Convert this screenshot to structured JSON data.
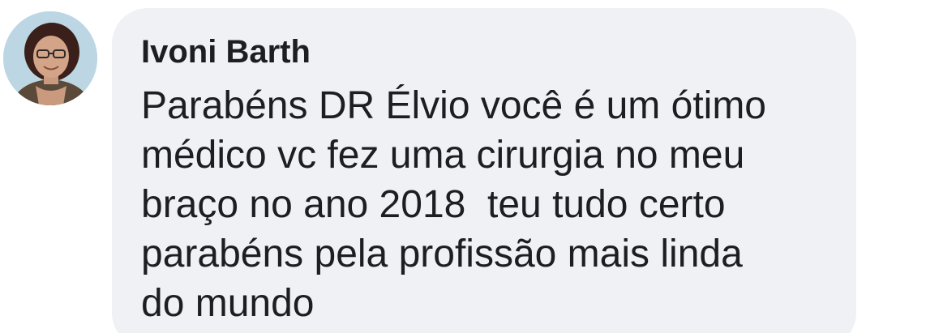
{
  "comment": {
    "author": "Ivoni Barth",
    "text_lines": [
      "Parabéns DR Élvio você é um ótimo",
      "médico vc fez uma cirurgia no meu",
      "braço no ano 2018  teu tudo certo",
      "parabéns pela profissão mais linda",
      "do mundo"
    ]
  },
  "colors": {
    "bubble_background": "#f0f1f5",
    "text": "#1c1e21"
  },
  "icons": {
    "avatar": "profile-photo"
  }
}
